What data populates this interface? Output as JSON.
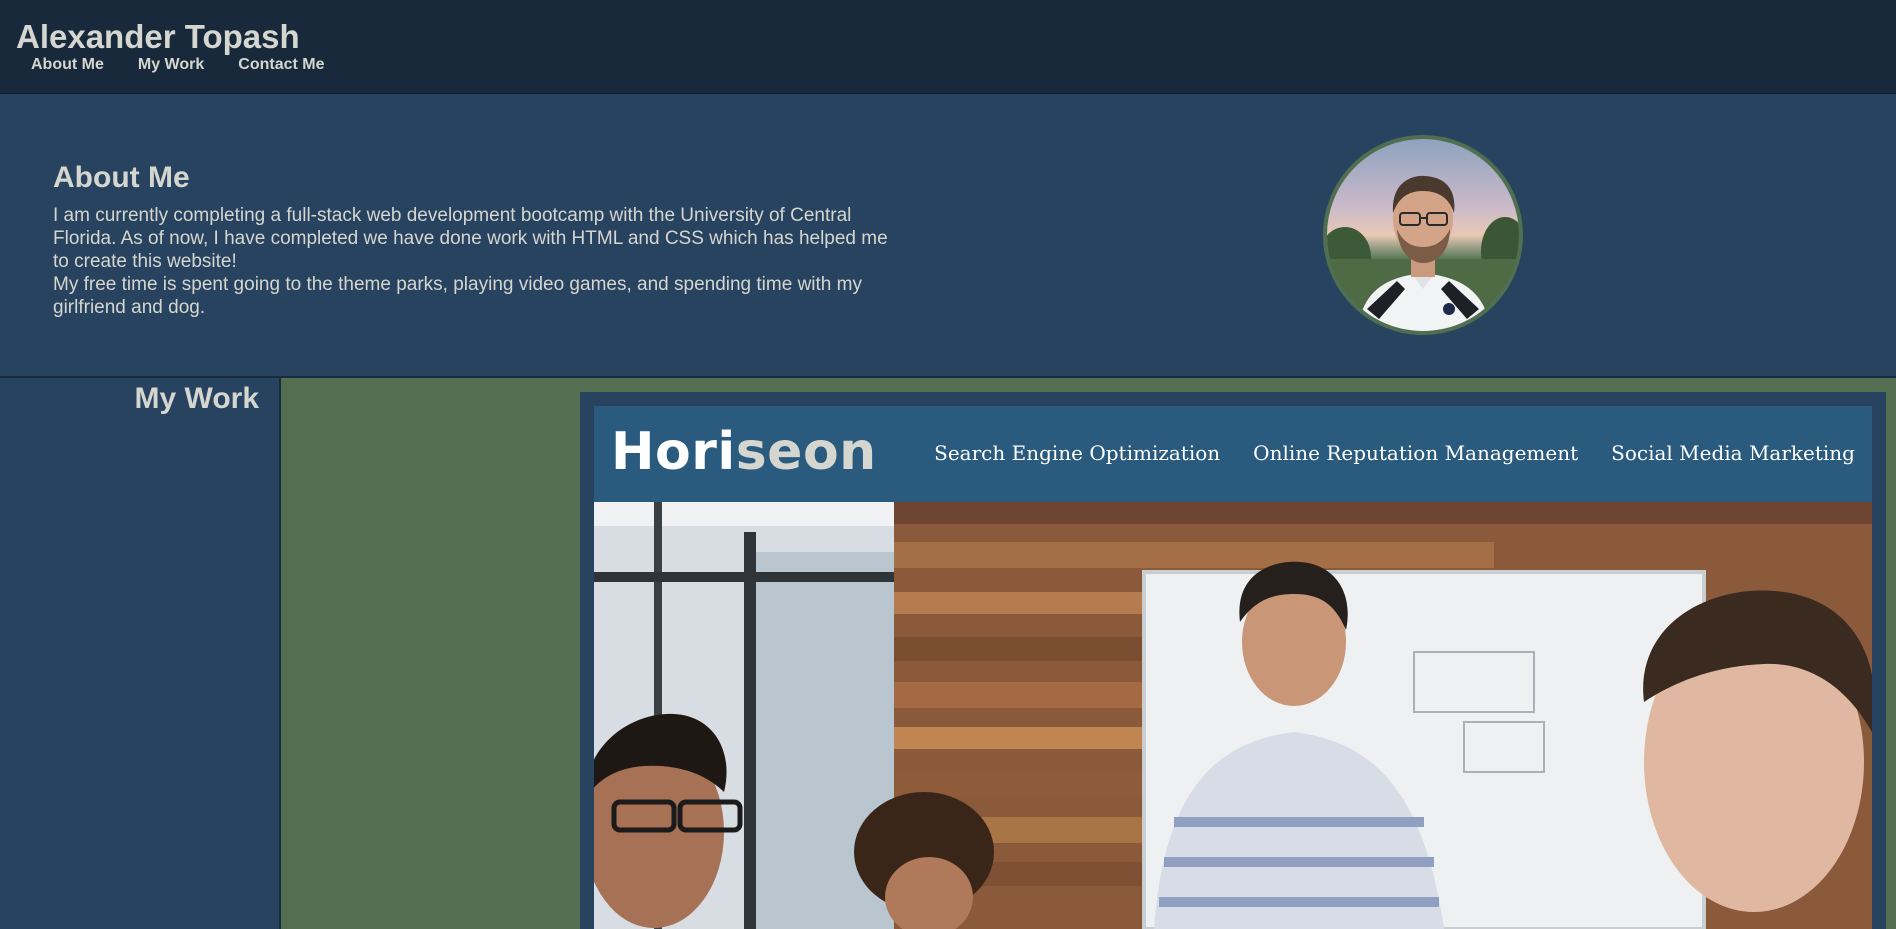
{
  "header": {
    "title": "Alexander Topash",
    "nav": [
      {
        "label": "About Me"
      },
      {
        "label": "My Work"
      },
      {
        "label": "Contact Me"
      }
    ]
  },
  "about": {
    "title": "About Me",
    "paragraphs": [
      "I am currently completing a full-stack web development bootcamp with the University of Central Florida. As of now, I have completed we have done work with HTML and CSS which has helped me to create this website!",
      "My free time is spent going to the theme parks, playing video games, and spending time with my girlfriend and dog."
    ]
  },
  "work": {
    "title": "My Work",
    "project": {
      "brand_main": "Hori",
      "brand_accent": "seon",
      "nav": [
        {
          "label": "Search Engine Optimization"
        },
        {
          "label": "Online Reputation Management"
        },
        {
          "label": "Social Media Marketing"
        }
      ]
    }
  },
  "colors": {
    "header_bg": "#17293a",
    "section_bg": "#28435f",
    "work_bg": "#546e51",
    "text": "#d4d6cf",
    "project_bar": "#2a5b7e",
    "portrait_border": "#4f6f50"
  },
  "icons": {
    "portrait": "profile-photo",
    "project_image": "team-meeting-photo"
  }
}
